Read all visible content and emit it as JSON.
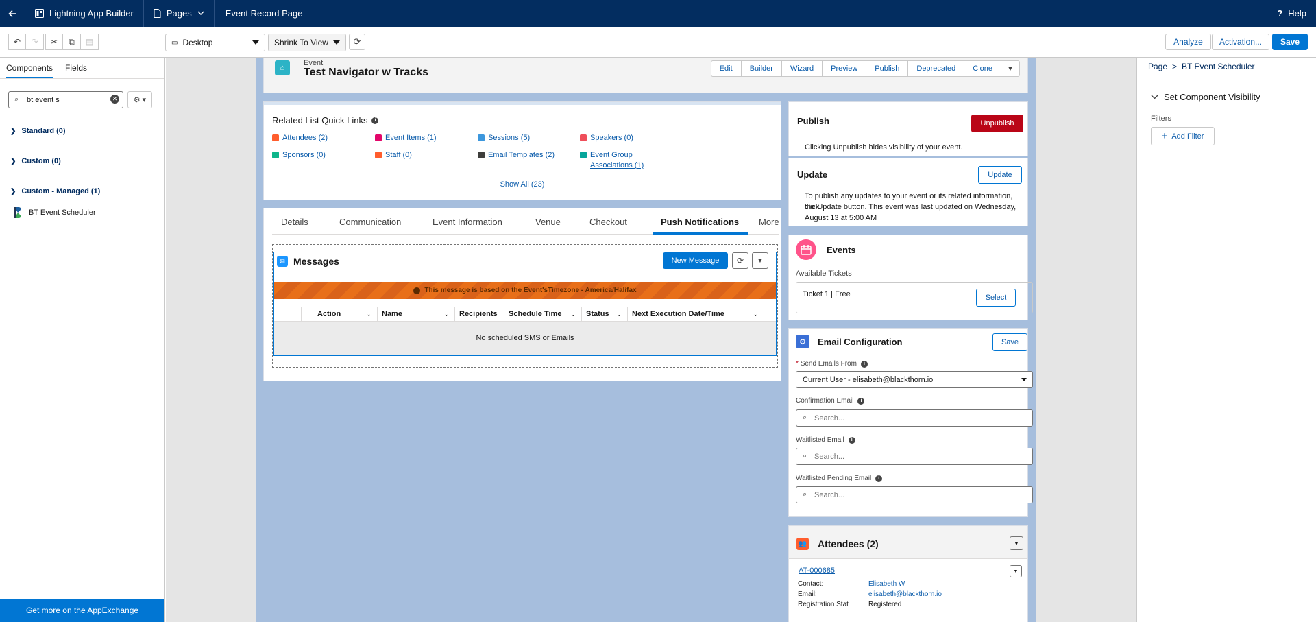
{
  "topbar": {
    "app_title": "Lightning App Builder",
    "pages_label": "Pages",
    "page_name": "Event Record Page",
    "help_label": "Help"
  },
  "toolbar": {
    "device": "Desktop",
    "zoom": "Shrink To View",
    "analyze_label": "Analyze",
    "activation_label": "Activation...",
    "save_label": "Save"
  },
  "left_panel": {
    "tabs": [
      "Components",
      "Fields"
    ],
    "search_value": "bt event s",
    "sections": [
      "Standard (0)",
      "Custom (0)",
      "Custom - Managed (1)"
    ],
    "component": "BT Event Scheduler",
    "appexchange_label": "Get more on the AppExchange"
  },
  "record_header": {
    "type": "Event",
    "title": "Test Navigator w Tracks",
    "buttons": [
      "Edit",
      "Builder",
      "Wizard",
      "Preview",
      "Publish",
      "Deprecated",
      "Clone"
    ]
  },
  "related_links": {
    "title": "Related List Quick Links",
    "items": [
      {
        "label": "Attendees (2)",
        "color": "#ff5d2d"
      },
      {
        "label": "Event Items (1)",
        "color": "#e3066a"
      },
      {
        "label": "Sessions (5)",
        "color": "#3c97dd"
      },
      {
        "label": "Speakers (0)",
        "color": "#ef4e5a"
      },
      {
        "label": "Sponsors (0)",
        "color": "#0eb58a"
      },
      {
        "label": "Staff (0)",
        "color": "#ff5d2d"
      },
      {
        "label": "Email Templates (2)",
        "color": "#3e3e3c"
      },
      {
        "label": "Event Group",
        "label2": "Associations (1)",
        "color": "#06a59a"
      }
    ],
    "show_all": "Show All (23)"
  },
  "tabs": [
    "Details",
    "Communication",
    "Event Information",
    "Venue",
    "Checkout",
    "Push Notifications",
    "More"
  ],
  "messages": {
    "title": "Messages",
    "new_button": "New Message",
    "banner": "This message is based on the Event'sTimezone - America/Halifax",
    "columns": [
      "Action",
      "Name",
      "Recipients",
      "Schedule Time",
      "Status",
      "Next Execution Date/Time"
    ],
    "empty_text": "No scheduled SMS or Emails"
  },
  "publish": {
    "title": "Publish",
    "button": "Unpublish",
    "text": "Clicking Unpublish hides visibility of your event."
  },
  "update": {
    "title": "Update",
    "button": "Update",
    "line1": "To publish any updates to your event or its related information, click",
    "line2": "the Update button. This event was last updated on Wednesday,",
    "line3": "August 13 at 5:00 AM"
  },
  "events": {
    "title": "Events",
    "available_label": "Available Tickets",
    "ticket": "Ticket 1 | Free",
    "select_button": "Select"
  },
  "email_config": {
    "title": "Email Configuration",
    "save_button": "Save",
    "required_mark": "*",
    "send_from_label": "Send Emails From",
    "send_from_value": "Current User - elisabeth@blackthorn.io",
    "confirmation_label": "Confirmation Email",
    "waitlisted_label": "Waitlisted Email",
    "waitlisted_pending_label": "Waitlisted Pending Email",
    "search_placeholder": "Search..."
  },
  "attendees": {
    "title": "Attendees (2)",
    "record_id": "AT-000685",
    "contact_label": "Contact:",
    "contact_value": "Elisabeth W",
    "email_label": "Email:",
    "email_value": "elisabeth@blackthorn.io",
    "reg_label": "Registration Stat",
    "reg_value": "Registered"
  },
  "right_panel": {
    "breadcrumb_root": "Page",
    "breadcrumb_sep": ">",
    "breadcrumb_current": "BT Event Scheduler",
    "visibility_title": "Set Component Visibility",
    "filters_label": "Filters",
    "add_filter": "Add Filter"
  }
}
